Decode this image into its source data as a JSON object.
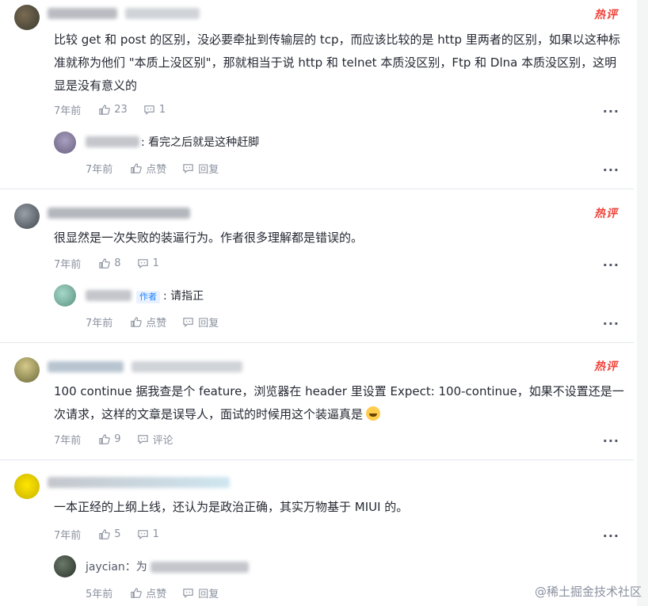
{
  "comments": [
    {
      "hot_badge": "热评",
      "content": "比较 get 和 post 的区别，没必要牵扯到传输层的 tcp，而应该比较的是 http 里两者的区别，如果以这种标准就称为他们 \"本质上没区别\"，那就相当于说 http 和 telnet 本质没区别，Ftp 和 Dlna 本质没区别，这明显是没有意义的",
      "time": "7年前",
      "likes": "23",
      "replies": "1",
      "reply": {
        "text": ": 看完之后就是这种赶脚",
        "time": "7年前",
        "like_label": "点赞",
        "reply_label": "回复"
      }
    },
    {
      "hot_badge": "热评",
      "content": "很显然是一次失败的装逼行为。作者很多理解都是错误的。",
      "time": "7年前",
      "likes": "8",
      "replies": "1",
      "reply": {
        "author_tag": "作者",
        "text": ": 请指正",
        "time": "7年前",
        "like_label": "点赞",
        "reply_label": "回复"
      }
    },
    {
      "hot_badge": "热评",
      "content": "100 continue 据我查是个 feature，浏览器在 header 里设置 Expect: 100-continue，如果不设置还是一次请求，这样的文章是误导人，面试的时候用这个装逼真是",
      "time": "7年前",
      "likes": "9",
      "comment_label": "评论"
    },
    {
      "content": "一本正经的上纲上线，还认为是政治正确，其实万物基于 MIUI 的。",
      "time": "7年前",
      "likes": "5",
      "replies": "1",
      "reply": {
        "name_fragment": "jaycian：为",
        "time": "5年前",
        "like_label": "点赞",
        "reply_label": "回复"
      }
    }
  ],
  "more_glyph": "···",
  "watermark": "@稀土掘金技术社区",
  "colors": {
    "hot": "#f0433a",
    "meta": "#8a919f",
    "text": "#252933",
    "author_tag": "#1e80ff"
  }
}
